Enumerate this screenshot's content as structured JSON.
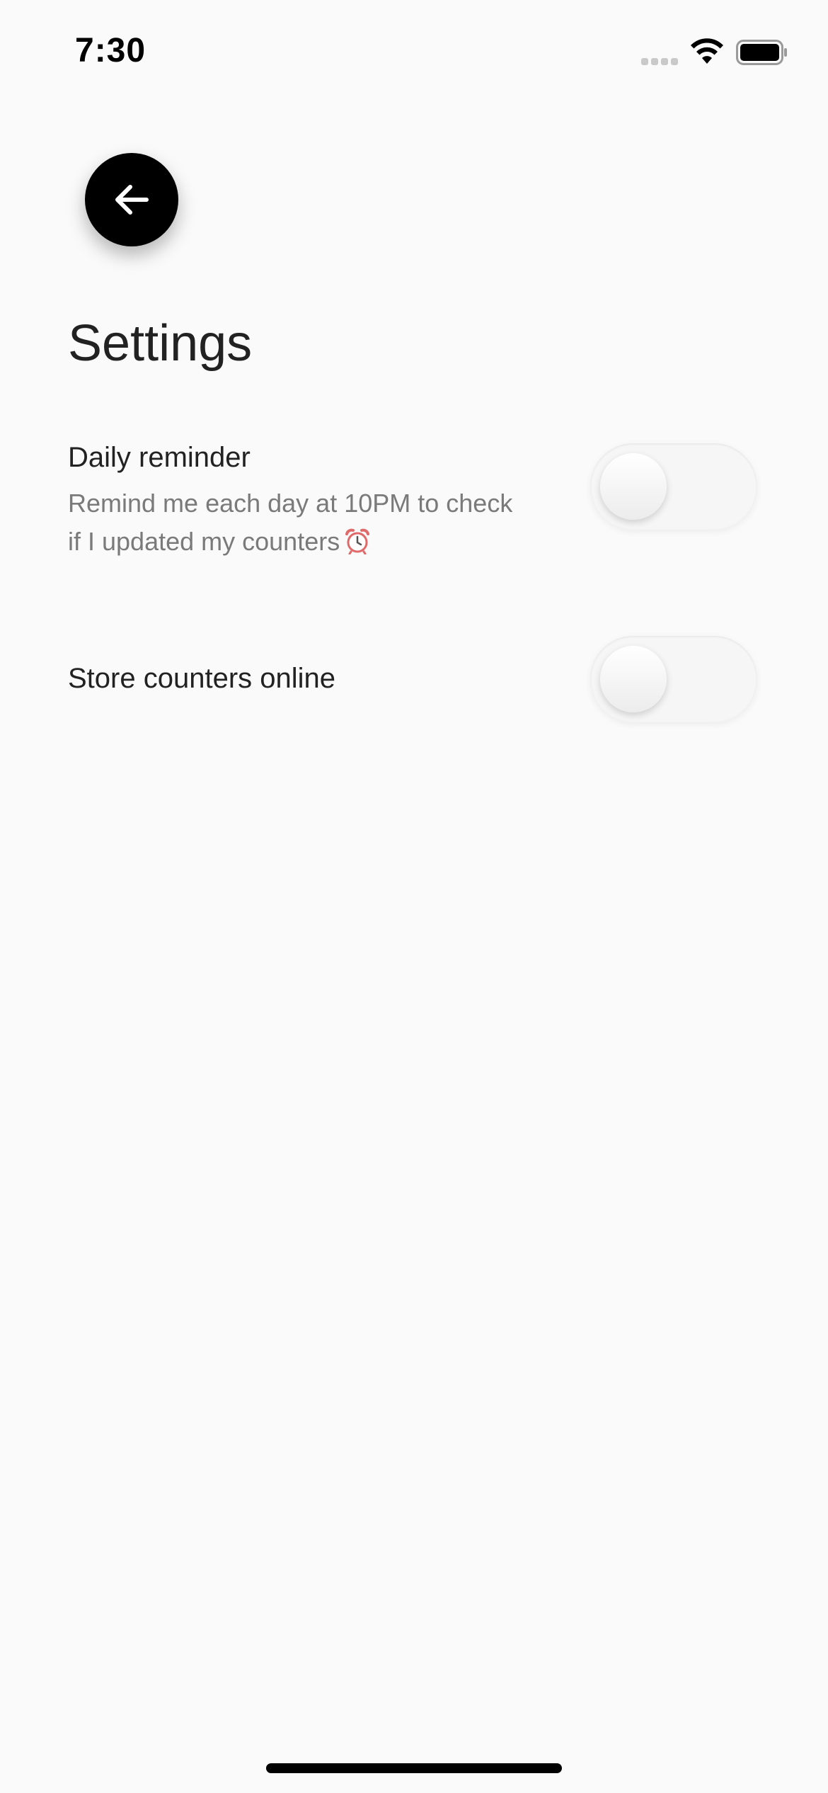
{
  "status_bar": {
    "time": "7:30",
    "icons": [
      "signal-icon",
      "wifi-icon",
      "battery-icon"
    ]
  },
  "nav": {
    "back_icon": "arrow-left-icon"
  },
  "page": {
    "title": "Settings"
  },
  "settings": [
    {
      "title": "Daily reminder",
      "description": "Remind me each day at 10PM to check if I updated my counters",
      "description_icon": "alarm-clock-icon",
      "enabled": false
    },
    {
      "title": "Store counters online",
      "enabled": false
    }
  ],
  "colors": {
    "background": "#fafafa",
    "back_button": "#000000",
    "text_primary": "#222222",
    "text_secondary": "#7a7a7a",
    "toggle_track": "#f6f6f6"
  }
}
